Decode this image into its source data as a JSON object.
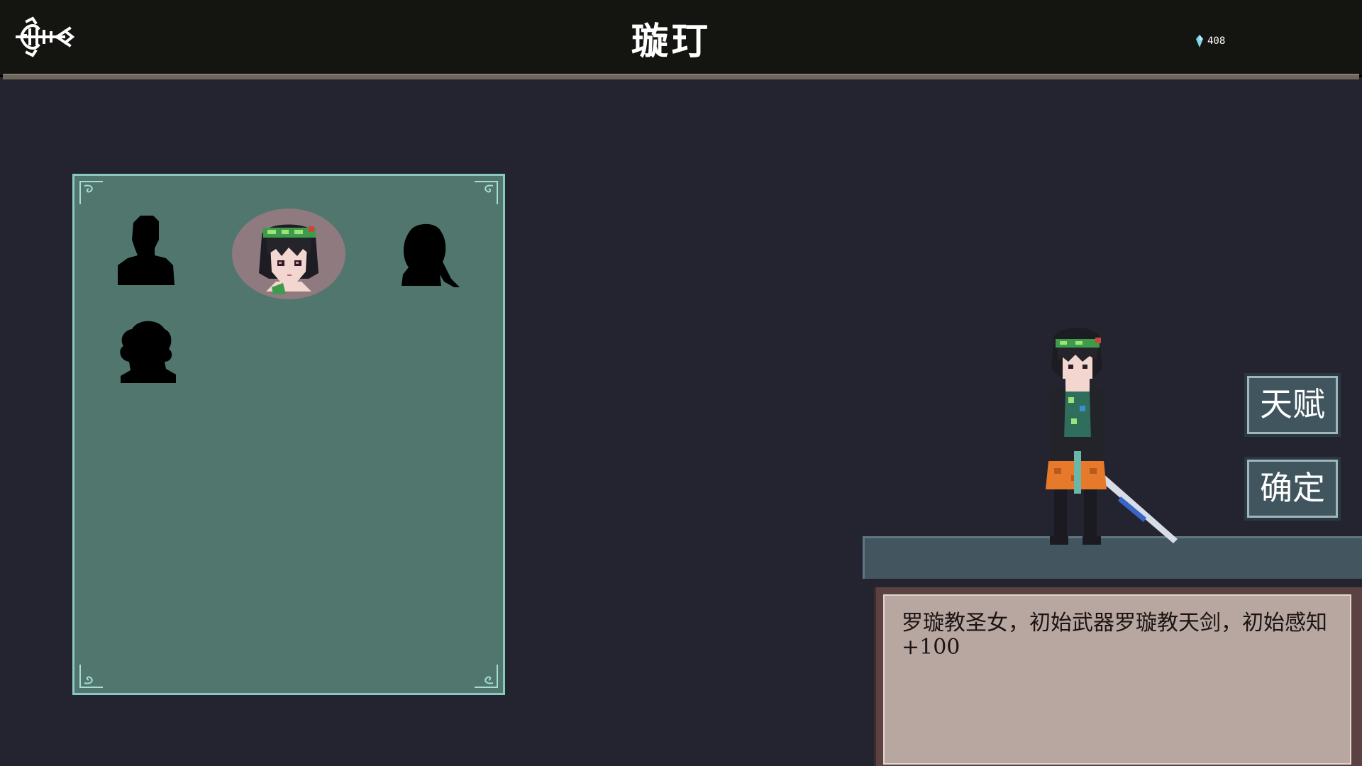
{
  "header": {
    "title": "璇玎",
    "back_icon": "fish-skeleton-icon",
    "currency": {
      "icon": "crystal-gem-icon",
      "amount": "408",
      "color": "#7fd6e8"
    }
  },
  "roster": {
    "slots": [
      {
        "id": "locked-1",
        "state": "locked",
        "icon": "short-hair-silhouette-icon"
      },
      {
        "id": "selected",
        "state": "selected",
        "icon": "saint-maiden-portrait-icon"
      },
      {
        "id": "locked-2",
        "state": "locked",
        "icon": "ponytail-silhouette-icon"
      },
      {
        "id": "locked-3",
        "state": "locked",
        "icon": "curly-hair-silhouette-icon"
      }
    ],
    "panel_color": "#50766e",
    "selected_ring_color": "#8f7a7f"
  },
  "actions": {
    "talent_label": "天赋",
    "confirm_label": "确定"
  },
  "description": {
    "text": "罗璇教圣女，初始武器罗璇教天剑，初始感知+100"
  }
}
